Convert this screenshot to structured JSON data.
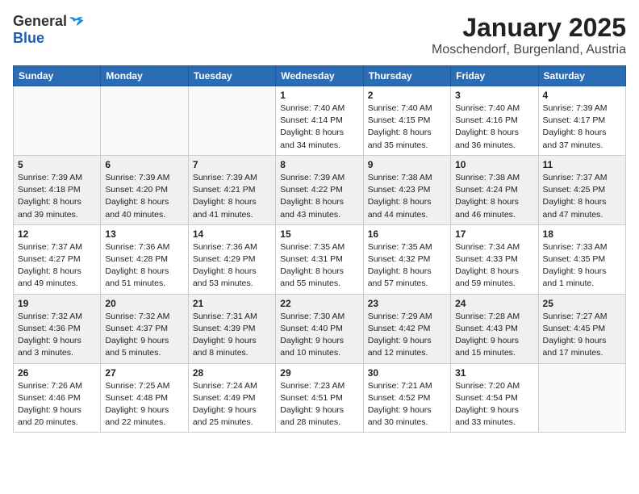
{
  "header": {
    "logo_general": "General",
    "logo_blue": "Blue",
    "month": "January 2025",
    "location": "Moschendorf, Burgenland, Austria"
  },
  "days_of_week": [
    "Sunday",
    "Monday",
    "Tuesday",
    "Wednesday",
    "Thursday",
    "Friday",
    "Saturday"
  ],
  "weeks": [
    [
      {
        "day": "",
        "info": ""
      },
      {
        "day": "",
        "info": ""
      },
      {
        "day": "",
        "info": ""
      },
      {
        "day": "1",
        "info": "Sunrise: 7:40 AM\nSunset: 4:14 PM\nDaylight: 8 hours\nand 34 minutes."
      },
      {
        "day": "2",
        "info": "Sunrise: 7:40 AM\nSunset: 4:15 PM\nDaylight: 8 hours\nand 35 minutes."
      },
      {
        "day": "3",
        "info": "Sunrise: 7:40 AM\nSunset: 4:16 PM\nDaylight: 8 hours\nand 36 minutes."
      },
      {
        "day": "4",
        "info": "Sunrise: 7:39 AM\nSunset: 4:17 PM\nDaylight: 8 hours\nand 37 minutes."
      }
    ],
    [
      {
        "day": "5",
        "info": "Sunrise: 7:39 AM\nSunset: 4:18 PM\nDaylight: 8 hours\nand 39 minutes."
      },
      {
        "day": "6",
        "info": "Sunrise: 7:39 AM\nSunset: 4:20 PM\nDaylight: 8 hours\nand 40 minutes."
      },
      {
        "day": "7",
        "info": "Sunrise: 7:39 AM\nSunset: 4:21 PM\nDaylight: 8 hours\nand 41 minutes."
      },
      {
        "day": "8",
        "info": "Sunrise: 7:39 AM\nSunset: 4:22 PM\nDaylight: 8 hours\nand 43 minutes."
      },
      {
        "day": "9",
        "info": "Sunrise: 7:38 AM\nSunset: 4:23 PM\nDaylight: 8 hours\nand 44 minutes."
      },
      {
        "day": "10",
        "info": "Sunrise: 7:38 AM\nSunset: 4:24 PM\nDaylight: 8 hours\nand 46 minutes."
      },
      {
        "day": "11",
        "info": "Sunrise: 7:37 AM\nSunset: 4:25 PM\nDaylight: 8 hours\nand 47 minutes."
      }
    ],
    [
      {
        "day": "12",
        "info": "Sunrise: 7:37 AM\nSunset: 4:27 PM\nDaylight: 8 hours\nand 49 minutes."
      },
      {
        "day": "13",
        "info": "Sunrise: 7:36 AM\nSunset: 4:28 PM\nDaylight: 8 hours\nand 51 minutes."
      },
      {
        "day": "14",
        "info": "Sunrise: 7:36 AM\nSunset: 4:29 PM\nDaylight: 8 hours\nand 53 minutes."
      },
      {
        "day": "15",
        "info": "Sunrise: 7:35 AM\nSunset: 4:31 PM\nDaylight: 8 hours\nand 55 minutes."
      },
      {
        "day": "16",
        "info": "Sunrise: 7:35 AM\nSunset: 4:32 PM\nDaylight: 8 hours\nand 57 minutes."
      },
      {
        "day": "17",
        "info": "Sunrise: 7:34 AM\nSunset: 4:33 PM\nDaylight: 8 hours\nand 59 minutes."
      },
      {
        "day": "18",
        "info": "Sunrise: 7:33 AM\nSunset: 4:35 PM\nDaylight: 9 hours\nand 1 minute."
      }
    ],
    [
      {
        "day": "19",
        "info": "Sunrise: 7:32 AM\nSunset: 4:36 PM\nDaylight: 9 hours\nand 3 minutes."
      },
      {
        "day": "20",
        "info": "Sunrise: 7:32 AM\nSunset: 4:37 PM\nDaylight: 9 hours\nand 5 minutes."
      },
      {
        "day": "21",
        "info": "Sunrise: 7:31 AM\nSunset: 4:39 PM\nDaylight: 9 hours\nand 8 minutes."
      },
      {
        "day": "22",
        "info": "Sunrise: 7:30 AM\nSunset: 4:40 PM\nDaylight: 9 hours\nand 10 minutes."
      },
      {
        "day": "23",
        "info": "Sunrise: 7:29 AM\nSunset: 4:42 PM\nDaylight: 9 hours\nand 12 minutes."
      },
      {
        "day": "24",
        "info": "Sunrise: 7:28 AM\nSunset: 4:43 PM\nDaylight: 9 hours\nand 15 minutes."
      },
      {
        "day": "25",
        "info": "Sunrise: 7:27 AM\nSunset: 4:45 PM\nDaylight: 9 hours\nand 17 minutes."
      }
    ],
    [
      {
        "day": "26",
        "info": "Sunrise: 7:26 AM\nSunset: 4:46 PM\nDaylight: 9 hours\nand 20 minutes."
      },
      {
        "day": "27",
        "info": "Sunrise: 7:25 AM\nSunset: 4:48 PM\nDaylight: 9 hours\nand 22 minutes."
      },
      {
        "day": "28",
        "info": "Sunrise: 7:24 AM\nSunset: 4:49 PM\nDaylight: 9 hours\nand 25 minutes."
      },
      {
        "day": "29",
        "info": "Sunrise: 7:23 AM\nSunset: 4:51 PM\nDaylight: 9 hours\nand 28 minutes."
      },
      {
        "day": "30",
        "info": "Sunrise: 7:21 AM\nSunset: 4:52 PM\nDaylight: 9 hours\nand 30 minutes."
      },
      {
        "day": "31",
        "info": "Sunrise: 7:20 AM\nSunset: 4:54 PM\nDaylight: 9 hours\nand 33 minutes."
      },
      {
        "day": "",
        "info": ""
      }
    ]
  ]
}
